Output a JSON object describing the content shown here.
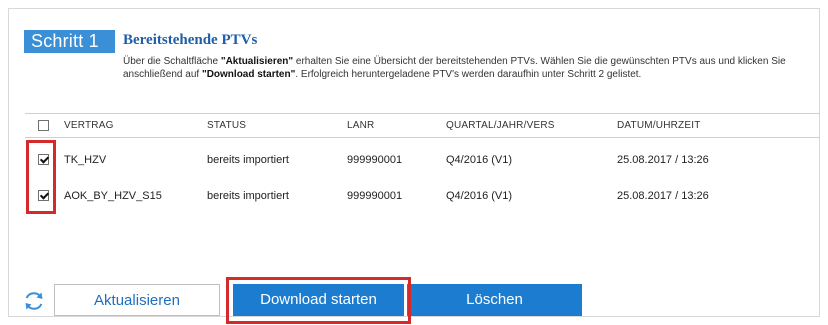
{
  "step": {
    "badge": "Schritt 1",
    "title": "Bereitstehende PTVs"
  },
  "description": {
    "part1": "Über die Schaltfläche ",
    "bold1": "\"Aktualisieren\"",
    "part2": " erhalten Sie eine Übersicht der bereitstehenden PTVs. Wählen Sie die gewünschten PTVs aus und klicken Sie anschließend auf ",
    "bold2": "\"Download starten\"",
    "part3": ". Erfolgreich heruntergeladene PTV's werden daraufhin unter Schritt 2 gelistet."
  },
  "table": {
    "select_all_checked": false,
    "columns": [
      "VERTRAG",
      "STATUS",
      "LANR",
      "QUARTAL/JAHR/VERS",
      "DATUM/UHRZEIT"
    ],
    "rows": [
      {
        "checked": true,
        "vertrag": "TK_HZV",
        "status": "bereits importiert",
        "lanr": "999990001",
        "quartal": "Q4/2016 (V1)",
        "datum": "25.08.2017 / 13:26"
      },
      {
        "checked": true,
        "vertrag": "AOK_BY_HZV_S15",
        "status": "bereits importiert",
        "lanr": "999990001",
        "quartal": "Q4/2016 (V1)",
        "datum": "25.08.2017 / 13:26"
      }
    ]
  },
  "buttons": {
    "refresh_icon": "refresh-icon",
    "aktualisieren": "Aktualisieren",
    "download": "Download starten",
    "loeschen": "Löschen"
  },
  "colors": {
    "accent": "#1c7cd0",
    "badge": "#3b8fd6",
    "title": "#1f5fa8",
    "highlight": "#d42a2a"
  }
}
